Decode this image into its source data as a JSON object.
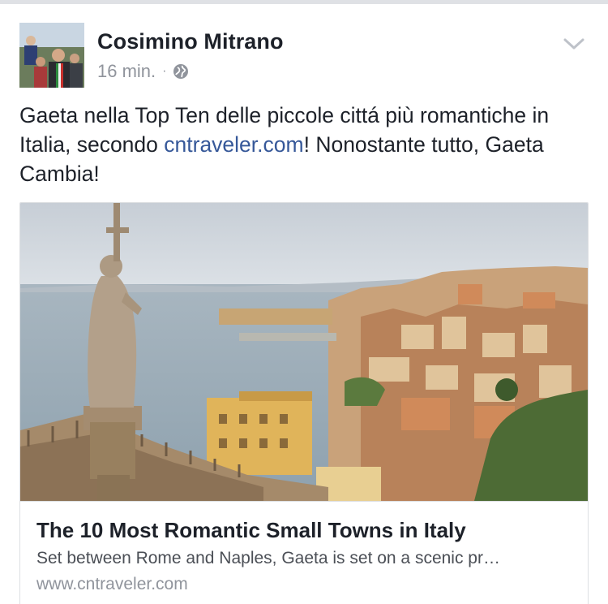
{
  "post": {
    "author": "Cosimino Mitrano",
    "time": "16 min.",
    "separator": "·",
    "privacy_icon": "globe-icon",
    "menu_icon": "chevron-down-icon",
    "text_before_link": "Gaeta nella Top Ten delle piccole cittá più romantiche in Italia, secondo ",
    "link_text": "cntraveler.com",
    "text_after_link": "! Nonostante tutto, Gaeta Cambia!"
  },
  "link_card": {
    "title": "The 10 Most Romantic Small Towns in Italy",
    "description": "Set between Rome and Naples, Gaeta is set on a scenic pr…",
    "domain": "www.cntraveler.com"
  },
  "colors": {
    "link": "#365899",
    "secondary_text": "#90949c",
    "primary_text": "#1d2129"
  }
}
